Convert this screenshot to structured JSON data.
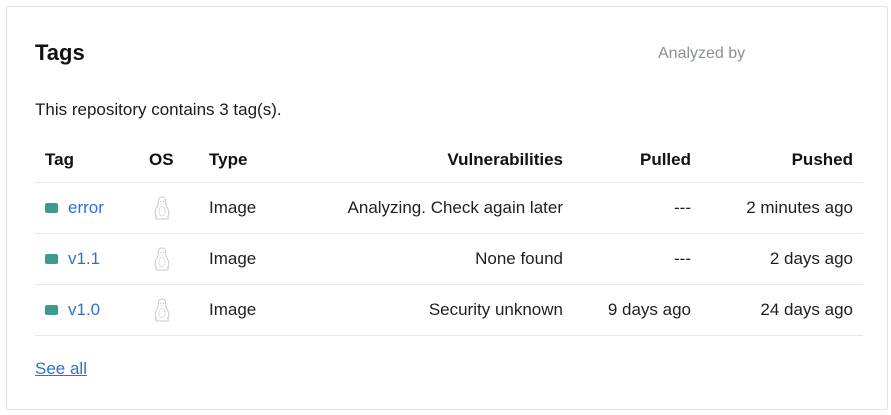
{
  "card": {
    "title": "Tags",
    "analyzed_by_label": "Analyzed by",
    "summary": "This repository contains 3 tag(s).",
    "see_all": "See all"
  },
  "table": {
    "headers": {
      "tag": "Tag",
      "os": "OS",
      "type": "Type",
      "vulnerabilities": "Vulnerabilities",
      "pulled": "Pulled",
      "pushed": "Pushed"
    },
    "rows": [
      {
        "tag": "error",
        "os_icon": "linux-penguin-icon",
        "type": "Image",
        "vulnerabilities": "Analyzing. Check again later",
        "pulled": "---",
        "pushed": "2 minutes ago"
      },
      {
        "tag": "v1.1",
        "os_icon": "linux-penguin-icon",
        "type": "Image",
        "vulnerabilities": "None found",
        "pulled": "---",
        "pushed": "2 days ago"
      },
      {
        "tag": "v1.0",
        "os_icon": "linux-penguin-icon",
        "type": "Image",
        "vulnerabilities": "Security unknown",
        "pulled": "9 days ago",
        "pushed": "24 days ago"
      }
    ]
  },
  "colors": {
    "status_dot": "#3a9c8c",
    "link": "#2f6fd6",
    "muted": "#8a8f98"
  }
}
